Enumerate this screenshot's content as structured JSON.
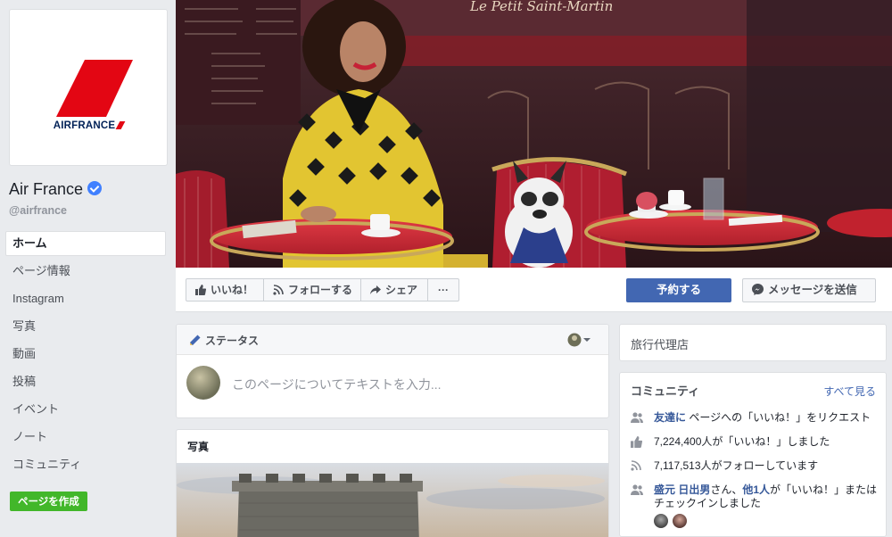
{
  "profile": {
    "logo_text": "AIRFRANCE",
    "name": "Air France",
    "handle": "@airfrance"
  },
  "nav": {
    "items": [
      "ホーム",
      "ページ情報",
      "Instagram",
      "写真",
      "動画",
      "投稿",
      "イベント",
      "ノート",
      "コミュニティ"
    ],
    "create_page": "ページを作成"
  },
  "actions": {
    "like": "いいね！",
    "follow": "フォローする",
    "share": "シェア",
    "more": "···",
    "book": "予約する",
    "message": "メッセージを送信"
  },
  "composer": {
    "tab": "ステータス",
    "placeholder": "このページについてテキストを入力..."
  },
  "photos": {
    "title": "写真"
  },
  "category": {
    "label": "旅行代理店"
  },
  "community": {
    "title": "コミュニティ",
    "see_all": "すべて見る",
    "invite_link": "友達に",
    "invite_text": "ページへの「いいね！」をリクエスト",
    "likes_text": "7,224,400人が「いいね！」しました",
    "follows_text": "7,117,513人がフォローしています",
    "friend_name": "盛元 日出男",
    "friend_san": "さん、",
    "friend_others": "他1人",
    "friend_text": "が「いいね！」または",
    "friend_text2": "チェックインしました"
  },
  "cover": {
    "sign": "Le Petit Saint-Martin"
  },
  "colors": {
    "brand_blue": "#4267b2",
    "create_green": "#42b72a",
    "airfrance_red": "#e30613",
    "airfrance_navy": "#002157"
  }
}
